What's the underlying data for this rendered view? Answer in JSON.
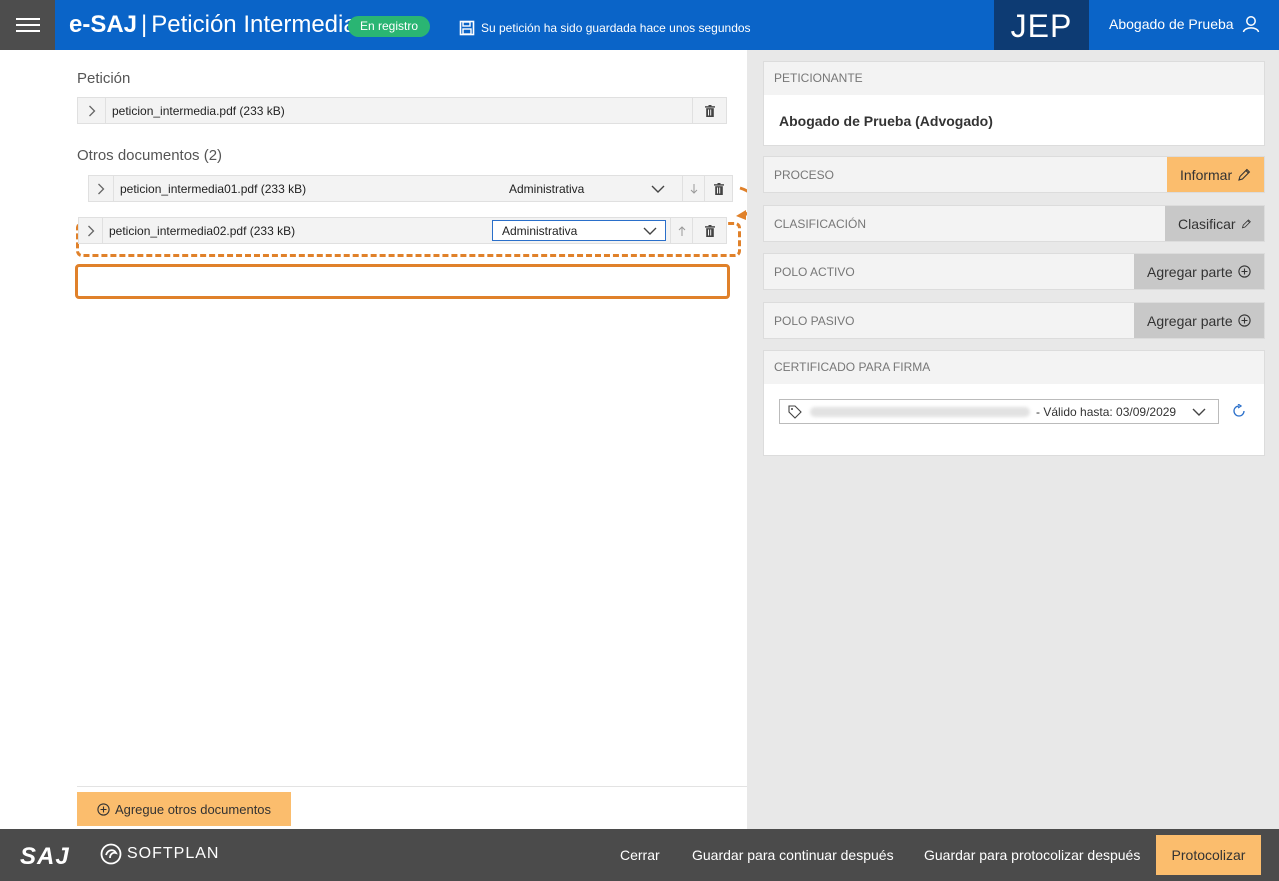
{
  "header": {
    "brand": "e-SAJ",
    "title": "Petición Intermedia",
    "status_badge": "En registro",
    "saved_message": "Su petición ha sido guardada hace unos segundos",
    "org": "JEP",
    "user_name": "Abogado de Prueba",
    "icons": {
      "menu": "hamburger-icon",
      "save": "floppy-disk-icon",
      "user": "user-icon"
    }
  },
  "peticion": {
    "section_title": "Petición",
    "file": "peticion_intermedia.pdf (233 kB)"
  },
  "otros": {
    "section_title": "Otros documentos (2)",
    "items": [
      {
        "file": "peticion_intermedia01.pdf (233 kB)",
        "type": "Administrativa"
      },
      {
        "file": "peticion_intermedia02.pdf (233 kB)",
        "type": "Administrativa"
      }
    ],
    "add_label": "Agregue otros documentos"
  },
  "right": {
    "peticionante": {
      "title": "Peticionante",
      "name": "Abogado de Prueba (Advogado)"
    },
    "proceso": {
      "label": "Proceso",
      "button": "Informar"
    },
    "clasificacion": {
      "label": "Clasificación",
      "button": "Clasificar"
    },
    "polo_activo": {
      "label": "Polo activo",
      "button": "Agregar parte"
    },
    "polo_pasivo": {
      "label": "Polo pasivo",
      "button": "Agregar parte"
    },
    "certificado": {
      "title": "Certificado para firma",
      "valid": "- Válido hasta: 03/09/2029"
    }
  },
  "footer": {
    "logo_saj": "SAJ",
    "logo_softplan": "SOFTPLAN",
    "cerrar": "Cerrar",
    "guardar_continuar": "Guardar para continuar después",
    "guardar_protocolizar": "Guardar para protocolizar después",
    "protocolizar": "Protocolizar"
  },
  "colors": {
    "header_blue": "#0a64c8",
    "jep_navy": "#0d3b73",
    "badge_green": "#2ab573",
    "accent_orange": "#fbbd6d",
    "highlight_orange": "#e0812a",
    "footer_dark": "#4b4b4b"
  }
}
